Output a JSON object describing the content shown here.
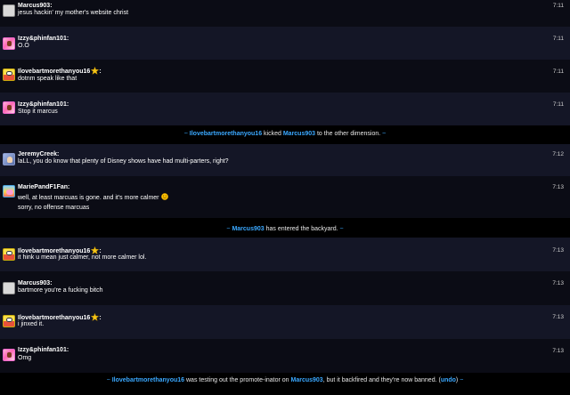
{
  "colors": {
    "background": "#000000",
    "row_odd": "#0b0c15",
    "row_even": "#141626",
    "username_link": "#3aa8ff",
    "timestamp": "#d0d0d0",
    "text": "#ffffff",
    "star": "#f5c518",
    "smiley": "#ffc300"
  },
  "messages": [
    {
      "user": "Marcus903",
      "avatar": "blank-avatar",
      "time": "7:11",
      "lines": [
        "jesus hackin' my mother's website christ"
      ]
    },
    {
      "user": "Izzy&phinfan101",
      "avatar": "pink-character-avatar",
      "time": "7:11",
      "lines": [
        "O.O"
      ]
    },
    {
      "user": "Ilovebartmorethanyou16",
      "avatar": "bart-avatar",
      "badge": "star-icon",
      "time": "7:11",
      "lines": [
        "dotnm speak like that"
      ]
    },
    {
      "user": "Izzy&phinfan101",
      "avatar": "pink-character-avatar",
      "time": "7:11",
      "lines": [
        "Stop it marcus"
      ]
    },
    {
      "user": "JeremyCreek",
      "avatar": "jeremy-avatar",
      "time": "7:12",
      "lines": [
        "laLL, you do know that plenty of Disney shows have had multi-parters, right?"
      ]
    },
    {
      "user": "MariePandF1Fan",
      "avatar": "marie-avatar",
      "time": "7:13",
      "lines": [
        "well, at least marcuas is gone. and it's more calmer",
        "sorry, no offense marcuas"
      ],
      "emoji": "smiley-icon"
    },
    {
      "user": "Ilovebartmorethanyou16",
      "avatar": "bart-avatar",
      "badge": "star-icon",
      "time": "7:13",
      "lines": [
        "it hink u mean just calmer, not more calmer lol."
      ]
    },
    {
      "user": "Marcus903",
      "avatar": "blank-avatar",
      "time": "7:13",
      "lines": [
        "bartmore you're a fucking bitch"
      ]
    },
    {
      "user": "Ilovebartmorethanyou16",
      "avatar": "bart-avatar",
      "badge": "star-icon",
      "time": "7:13",
      "lines": [
        "i jinxed it."
      ]
    },
    {
      "user": "Izzy&phinfan101",
      "avatar": "pink-character-avatar",
      "time": "7:13",
      "lines": [
        "Omg"
      ]
    }
  ],
  "system_messages": [
    {
      "tilde_open": "~",
      "user1": "Ilovebartmorethanyou16",
      "text1": " kicked ",
      "user2": "Marcus903",
      "text2": " to the other dimension. ",
      "tilde_close": "~"
    },
    {
      "tilde_open": "~",
      "user1": "Marcus903",
      "text1": " has entered the backyard. ",
      "tilde_close": "~"
    },
    {
      "tilde_open": "~",
      "user1": "Ilovebartmorethanyou16",
      "text1": " was testing out the promote-inator on ",
      "user2": "Marcus903",
      "text2": ", but it backfired and they're now banned. (",
      "undo": "undo",
      "text3": ") ",
      "tilde_close": "~"
    }
  ]
}
